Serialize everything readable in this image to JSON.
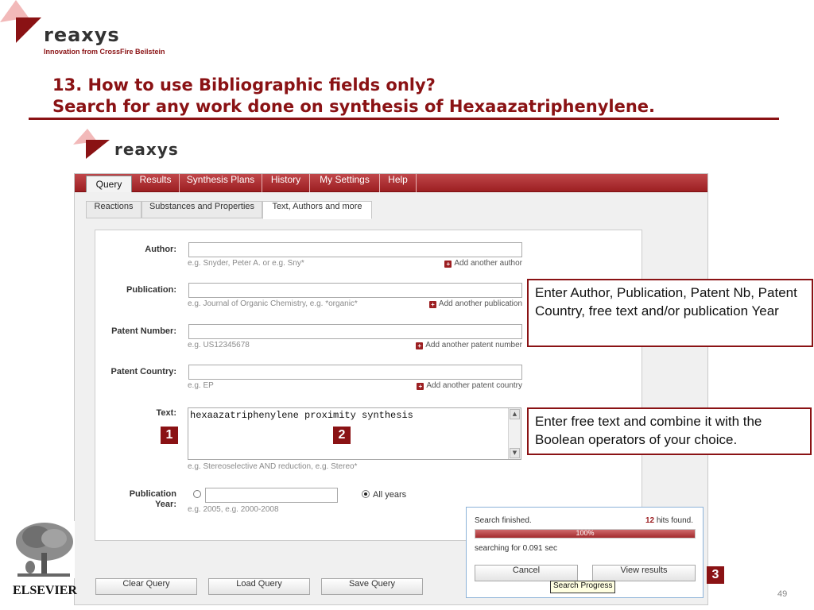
{
  "slide": {
    "brand_word": "reaxys",
    "brand_tagline": "Innovation from CrossFire Beilstein",
    "title_line1": "13. How to use Bibliographic fields only?",
    "title_line2": "Search for any work done on synthesis of Hexaazatriphenylene.",
    "page_number": "49",
    "footer_publisher": "ELSEVIER"
  },
  "app": {
    "logo_word": "reaxys",
    "menu": [
      "Query",
      "Results",
      "Synthesis Plans",
      "History",
      "My Settings",
      "Help"
    ],
    "active_menu": "Query",
    "subtabs": [
      "Reactions",
      "Substances and Properties",
      "Text, Authors and more"
    ],
    "active_subtab": "Text, Authors and more",
    "fields": {
      "author": {
        "label": "Author:",
        "value": "",
        "hint": "e.g. Snyder, Peter A. or e.g. Sny*",
        "add_label": "Add another author"
      },
      "publication": {
        "label": "Publication:",
        "value": "",
        "hint": "e.g. Journal of Organic Chemistry, e.g. *organic*",
        "add_label": "Add another publication"
      },
      "patent_number": {
        "label": "Patent Number:",
        "value": "",
        "hint": "e.g. US12345678",
        "add_label": "Add another patent number"
      },
      "patent_country": {
        "label": "Patent Country:",
        "value": "",
        "hint": "e.g. EP",
        "add_label": "Add another patent country"
      },
      "text": {
        "label": "Text:",
        "value": "hexaazatriphenylene proximity synthesis",
        "hint": "e.g. Stereoselective AND reduction, e.g. Stereo*"
      },
      "year": {
        "label_line1": "Publication",
        "label_line2": "Year:",
        "value": "",
        "hint": "e.g. 2005, e.g. 2000-2008",
        "all_years_label": "All years",
        "all_years_selected": true
      }
    },
    "buttons": {
      "clear": "Clear Query",
      "load": "Load Query",
      "save": "Save Query"
    }
  },
  "progress": {
    "status": "Search finished.",
    "hits_count": "12",
    "hits_suffix": " hits found.",
    "percent_label": "100%",
    "percent": 100,
    "timing": "searching for 0.091 sec",
    "cancel_label": "Cancel",
    "view_label": "View results",
    "tooltip": "Search Progress"
  },
  "annotations": {
    "callout_fields": "Enter Author, Publication, Patent Nb, Patent Country, free text and/or publication Year",
    "callout_text": "Enter free text and combine it with the Boolean operators of your choice.",
    "step1": "1",
    "step2": "2",
    "step3": "3"
  },
  "colors": {
    "brand_red": "#8a1214",
    "menu_red": "#9c1f22",
    "progress_border": "#8db3d8"
  }
}
